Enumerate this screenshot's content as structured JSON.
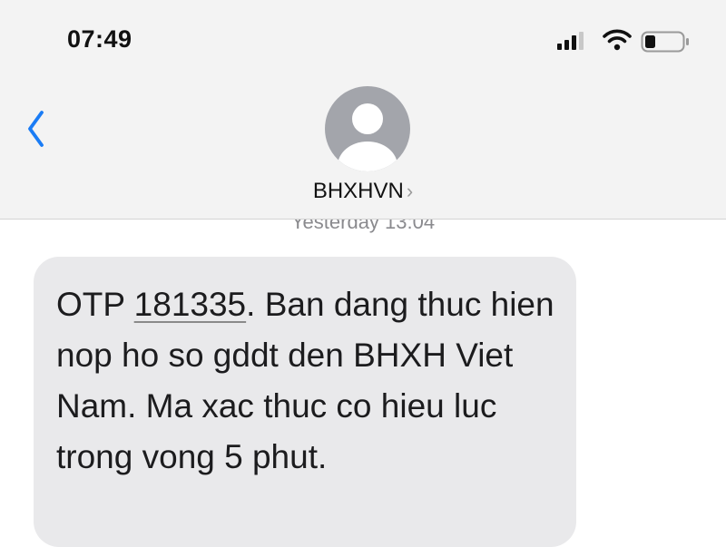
{
  "status_bar": {
    "time": "07:49",
    "icons": [
      "signal-icon",
      "wifi-icon",
      "battery-icon"
    ]
  },
  "header": {
    "back_icon": "chevron-left-icon",
    "avatar_icon": "person-icon",
    "contact_name": "BHXHVN",
    "contact_chevron": "›"
  },
  "thread": {
    "timestamp": "Yesterday 13:04"
  },
  "message": {
    "prefix": "OTP ",
    "code": "181335",
    "body": ". Ban dang thuc hien nop ho so gddt den BHXH Viet Nam. Ma xac thuc co hieu luc trong vong 5 phut."
  },
  "colors": {
    "accent": "#1a7cf5",
    "header_bg": "#f3f3f3",
    "bubble_bg": "#e9e9eb",
    "avatar_bg": "#a3a5ab"
  }
}
